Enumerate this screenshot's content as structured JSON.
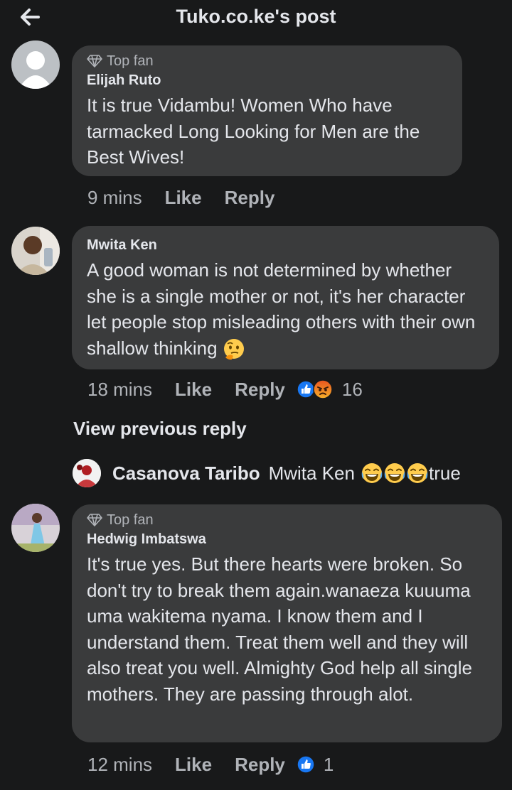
{
  "header": {
    "title": "Tuko.co.ke's post",
    "back_icon": "arrow-left-icon"
  },
  "comments": [
    {
      "badge": "Top fan",
      "author": "Elijah Ruto",
      "text": "It is true Vidambu! Women Who have tarmacked Long Looking for Men are the Best Wives!",
      "time": "9 mins",
      "like": "Like",
      "reply": "Reply"
    },
    {
      "author": "Mwita Ken",
      "text": "A good woman is not determined by whether she is a single mother or not, it's her character let people stop misleading others with their own shallow thinking",
      "emoji": "thinking-face",
      "time": "18 mins",
      "like": "Like",
      "reply": "Reply",
      "reactions": [
        "like",
        "angry"
      ],
      "reaction_count": "16"
    },
    {
      "badge": "Top fan",
      "author": "Hedwig Imbatswa",
      "text": "It's true yes. But there hearts were broken. So don't try to break them again.wanaeza kuuuma uma wakitema nyama. I know them and I understand them. Treat them well and they will also treat you well.  Almighty God help all single mothers.  They are passing through alot.",
      "time": "12 mins",
      "like": "Like",
      "reply": "Reply",
      "reactions": [
        "like"
      ],
      "reaction_count": "1"
    }
  ],
  "view_previous": "View previous reply",
  "reply_preview": {
    "author": "Casanova Taribo",
    "mention": "Mwita Ken",
    "emojis": [
      "tears-of-joy",
      "tears-of-joy",
      "tears-of-joy"
    ],
    "text": "true"
  },
  "colors": {
    "background": "#18191a",
    "bubble": "#3a3b3c",
    "text": "#e4e6eb",
    "secondary": "#b0b3b8",
    "like_blue": "#1877f2"
  }
}
